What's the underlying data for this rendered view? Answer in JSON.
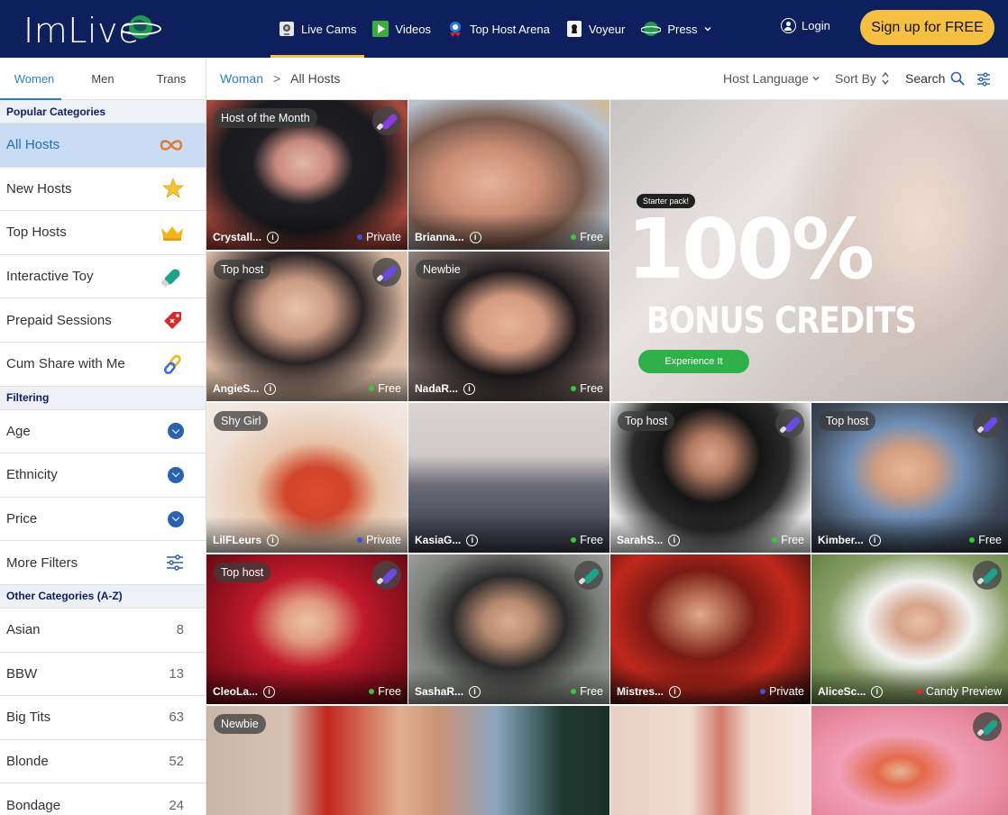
{
  "header": {
    "logo_text": "ImLive",
    "nav": [
      {
        "label": "Live Cams",
        "icon": "webcam-icon"
      },
      {
        "label": "Videos",
        "icon": "play-icon"
      },
      {
        "label": "Top Host Arena",
        "icon": "medal-icon"
      },
      {
        "label": "Voyeur",
        "icon": "keyhole-icon"
      },
      {
        "label": "Press",
        "icon": "globe-icon"
      }
    ],
    "login_label": "Login",
    "signup_label": "Sign up for FREE",
    "colors": {
      "bg": "#0d1f5c",
      "accent": "#f5c042"
    }
  },
  "sidebar": {
    "tabs": [
      "Women",
      "Men",
      "Trans"
    ],
    "popular_heading": "Popular Categories",
    "popular": [
      {
        "label": "All Hosts",
        "icon": "infinity-icon"
      },
      {
        "label": "New Hosts",
        "icon": "star-icon"
      },
      {
        "label": "Top Hosts",
        "icon": "crown-icon"
      },
      {
        "label": "Interactive Toy",
        "icon": "toy-icon"
      },
      {
        "label": "Prepaid Sessions",
        "icon": "price-tag-icon"
      },
      {
        "label": "Cum Share with Me",
        "icon": "link-icon"
      }
    ],
    "filtering_heading": "Filtering",
    "filters": [
      {
        "label": "Age"
      },
      {
        "label": "Ethnicity"
      },
      {
        "label": "Price"
      },
      {
        "label": "More Filters"
      }
    ],
    "other_heading": "Other Categories (A-Z)",
    "other": [
      {
        "label": "Asian",
        "count": "8"
      },
      {
        "label": "BBW",
        "count": "13"
      },
      {
        "label": "Big Tits",
        "count": "63"
      },
      {
        "label": "Blonde",
        "count": "52"
      },
      {
        "label": "Bondage",
        "count": "24"
      }
    ]
  },
  "topbar": {
    "crumb_root": "Woman",
    "crumb_sep": ">",
    "crumb_current": "All Hosts",
    "host_language": "Host Language",
    "sort_by": "Sort By",
    "search": "Search"
  },
  "promo": {
    "starter": "Starter pack!",
    "big": "100%",
    "bonus": "BONUS CREDITS",
    "cta": "Experience It"
  },
  "hosts": [
    {
      "name": "Crystall...",
      "status": "Private",
      "badge": "Host of the Month",
      "toy": "#8a3be0"
    },
    {
      "name": "Brianna...",
      "status": "Free",
      "badge": "",
      "toy": ""
    },
    {
      "name": "AngieS...",
      "status": "Free",
      "badge": "Top host",
      "toy": "#6a4be0"
    },
    {
      "name": "NadaR...",
      "status": "Free",
      "badge": "Newbie",
      "toy": ""
    },
    {
      "name": "LilFLeurs",
      "status": "Private",
      "badge": "Shy Girl",
      "toy": ""
    },
    {
      "name": "KasiaG...",
      "status": "Free",
      "badge": "",
      "toy": ""
    },
    {
      "name": "SarahS...",
      "status": "Free",
      "badge": "Top host",
      "toy": "#6a4be0"
    },
    {
      "name": "Kimber...",
      "status": "Free",
      "badge": "Top host",
      "toy": "#6a4be0"
    },
    {
      "name": "CleoLa...",
      "status": "Free",
      "badge": "Top host",
      "toy": "#6a4be0"
    },
    {
      "name": "SashaR...",
      "status": "Free",
      "badge": "",
      "toy": "#1fa08a"
    },
    {
      "name": "Mistres...",
      "status": "Private",
      "badge": "",
      "toy": ""
    },
    {
      "name": "AliceSc...",
      "status": "Candy Preview",
      "badge": "",
      "toy": "#1fa08a"
    },
    {
      "name": "",
      "status": "",
      "badge": "Newbie",
      "toy": ""
    },
    {
      "name": "",
      "status": "",
      "badge": "",
      "toy": ""
    },
    {
      "name": "",
      "status": "",
      "badge": "",
      "toy": "#1fa08a"
    }
  ]
}
